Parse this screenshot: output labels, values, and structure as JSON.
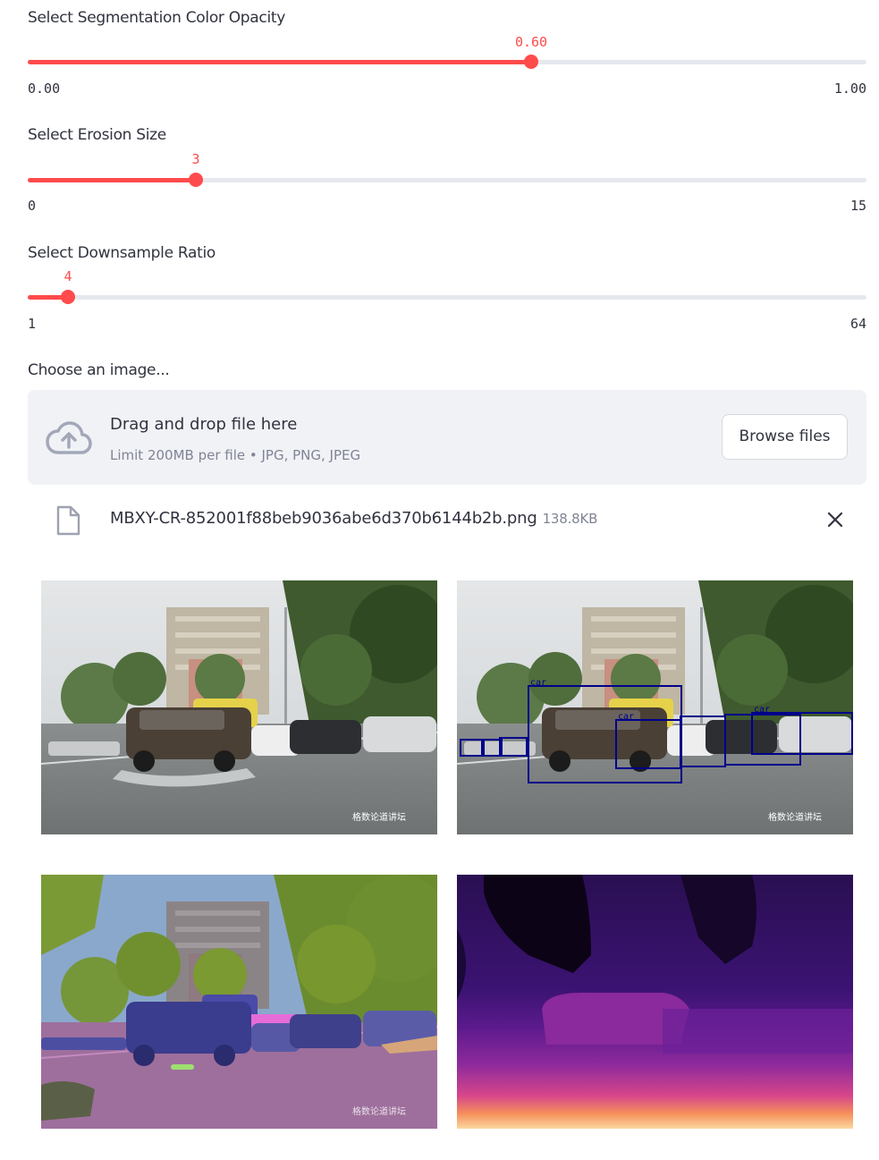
{
  "sliders": [
    {
      "label": "Select Segmentation Color Opacity",
      "value_text": "0.60",
      "min_text": "0.00",
      "max_text": "1.00",
      "fraction": 0.6
    },
    {
      "label": "Select Erosion Size",
      "value_text": "3",
      "min_text": "0",
      "max_text": "15",
      "fraction": 0.2
    },
    {
      "label": "Select Downsample Ratio",
      "value_text": "4",
      "min_text": "1",
      "max_text": "64",
      "fraction": 0.0476
    }
  ],
  "uploader": {
    "label": "Choose an image...",
    "drop_title": "Drag and drop file here",
    "drop_subtitle": "Limit 200MB per file • JPG, PNG, JPEG",
    "browse_label": "Browse files"
  },
  "file": {
    "name": "MBXY-CR-852001f88beb9036abe6d370b6144b2b.png",
    "size": "138.8KB"
  },
  "images": {
    "original": "street-flood-photo",
    "detection": "detection-boxes-photo",
    "segmentation": "segmentation-overlay",
    "depth": "depth-map",
    "detection_label": "car",
    "watermark": "格数论道讲坛"
  },
  "colors": {
    "accent": "#ff4b4b",
    "track": "#e6e8ee",
    "dropzone_bg": "#f0f2f6",
    "box": "#00008b"
  }
}
